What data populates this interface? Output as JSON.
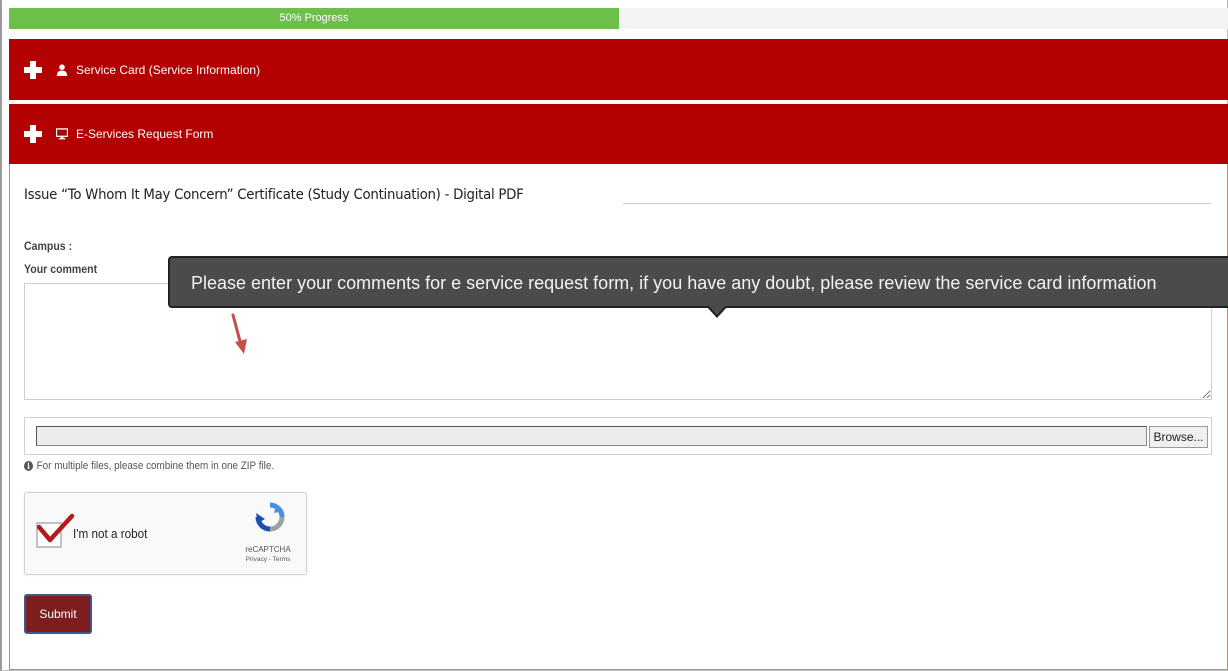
{
  "progress": {
    "label": "50% Progress",
    "percent": 50
  },
  "panels": [
    {
      "label": "Service Card (Service Information)",
      "icon": "user-icon"
    },
    {
      "label": "E-Services Request Form",
      "icon": "monitor-icon"
    }
  ],
  "form": {
    "title": "Issue “To Whom It May Concern” Certificate (Study Continuation) - Digital PDF",
    "campus_label": "Campus :",
    "comment_label": "Your comment",
    "comment_value": "",
    "tooltip": "Please enter your comments for e service request form, if you have any doubt, please review the service card information",
    "browse_label": "Browse...",
    "help_text": "For multiple files, please combine them in one ZIP file.",
    "submit_label": "Submit"
  },
  "recaptcha": {
    "label": "I'm not a robot",
    "brand": "reCAPTCHA",
    "terms": "Privacy - Terms",
    "checked": true
  },
  "colors": {
    "header_red": "#b30000",
    "progress_green": "#6cc04a",
    "submit_maroon": "#7d1d1d"
  }
}
